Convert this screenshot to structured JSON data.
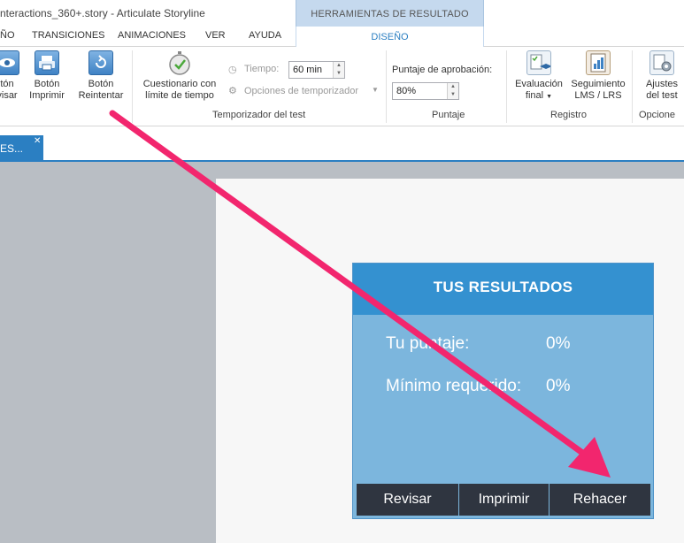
{
  "window": {
    "title": "nteractions_360+.story - Articulate Storyline"
  },
  "context_tab": {
    "header": "HERRAMIENTAS DE RESULTADO",
    "active_tab": "DISEÑO"
  },
  "tabs": [
    "ÑO",
    "TRANSICIONES",
    "ANIMACIONES",
    "VER",
    "AYUDA"
  ],
  "ribbon": {
    "btn_revisar": [
      "tón",
      "visar"
    ],
    "btn_imprimir": [
      "Botón",
      "Imprimir"
    ],
    "btn_reintentar": [
      "Botón",
      "Reintentar"
    ],
    "btn_cuestionario": [
      "Cuestionario con",
      "límite de tiempo"
    ],
    "tiempo_label": "Tiempo:",
    "tiempo_value": "60 min",
    "opciones_temporizador": "Opciones de temporizador",
    "group_temporizador": "Temporizador del test",
    "puntaje_label": "Puntaje de aprobación:",
    "puntaje_value": "80%",
    "group_puntaje": "Puntaje",
    "btn_evaluacion": [
      "Evaluación",
      "final"
    ],
    "btn_seguimiento": [
      "Seguimiento",
      "LMS / LRS"
    ],
    "group_registro": "Registro",
    "btn_ajustes": [
      "Ajustes",
      "del test"
    ],
    "group_opciones": "Opcione"
  },
  "document_tab": {
    "label": "ES..."
  },
  "results": {
    "title": "TUS RESULTADOS",
    "score_label": "Tu puntaje:",
    "score_value": "0%",
    "required_label": "Mínimo requerido:",
    "required_value": "0%",
    "buttons": [
      "Revisar",
      "Imprimir",
      "Rehacer"
    ]
  },
  "colors": {
    "accent": "#2b7fc2",
    "panel": "#7cb6dd",
    "panel_header": "#3491d0",
    "button": "#2f3540",
    "arrow": "#f2266e"
  }
}
